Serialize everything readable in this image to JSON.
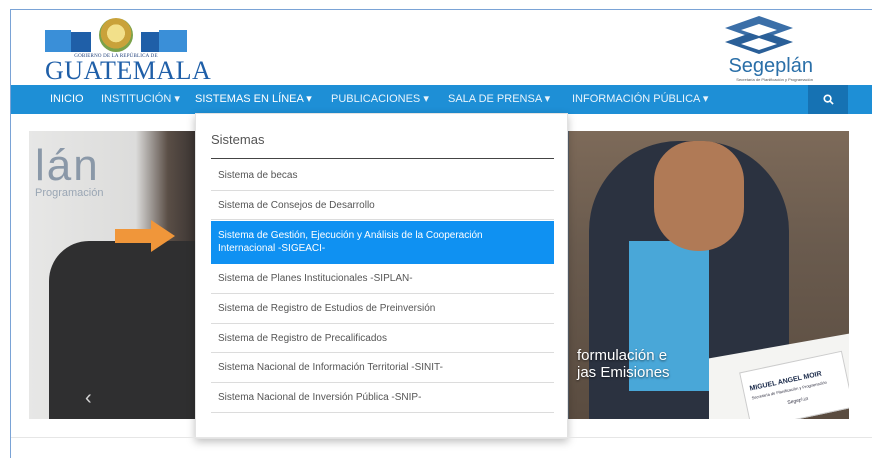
{
  "header": {
    "gt_logo": {
      "small_text": "GOBIERNO DE LA REPÚBLICA DE",
      "big_text": "GUATEMALA"
    },
    "segeplan_logo": {
      "name": "Segeplán",
      "subtitle": "Secretaría de Planificación y Programación"
    }
  },
  "navbar": {
    "items": [
      {
        "label": "INICIO",
        "caret": ""
      },
      {
        "label": "INSTITUCIÓN",
        "caret": "▾"
      },
      {
        "label": "SISTEMAS EN LÍNEA",
        "caret": "▾"
      },
      {
        "label": "PUBLICACIONES",
        "caret": "▾"
      },
      {
        "label": "SALA DE PRENSA",
        "caret": "▾"
      },
      {
        "label": "INFORMACIÓN PÚBLICA",
        "caret": "▾"
      }
    ],
    "search_icon": "search-icon"
  },
  "dropdown": {
    "title": "Sistemas",
    "items": [
      {
        "label": "Sistema de becas"
      },
      {
        "label": "Sistema de Consejos de Desarrollo"
      },
      {
        "label_line1": "Sistema de Gestión, Ejecución y Análisis de la Cooperación",
        "label_line2": "Internacional -SIGEACI-",
        "selected": true
      },
      {
        "label": "Sistema de Planes Institucionales -SIPLAN-"
      },
      {
        "label": "Sistema de Registro de Estudios de Preinversión"
      },
      {
        "label": "Sistema de Registro de Precalificados"
      },
      {
        "label": "Sistema Nacional de Información Territorial -SINIT-"
      },
      {
        "label": "Sistema Nacional de Inversión Pública -SNIP-"
      }
    ]
  },
  "banner": {
    "left_text": "lán",
    "left_sub": "Programación",
    "caption_line1": "formulación e",
    "caption_line2": "jas Emisiones",
    "nameplate_name": "MIGUEL ANGEL MOIR",
    "nameplate_sub": "Secretaría de Planificación y Programación",
    "nameplate_org": "Segeplán",
    "prev_icon": "‹",
    "next_icon": "›"
  },
  "colors": {
    "navbar": "#1e8fd6",
    "selected_item": "#0f91f2",
    "arrow": "#f0963a"
  }
}
